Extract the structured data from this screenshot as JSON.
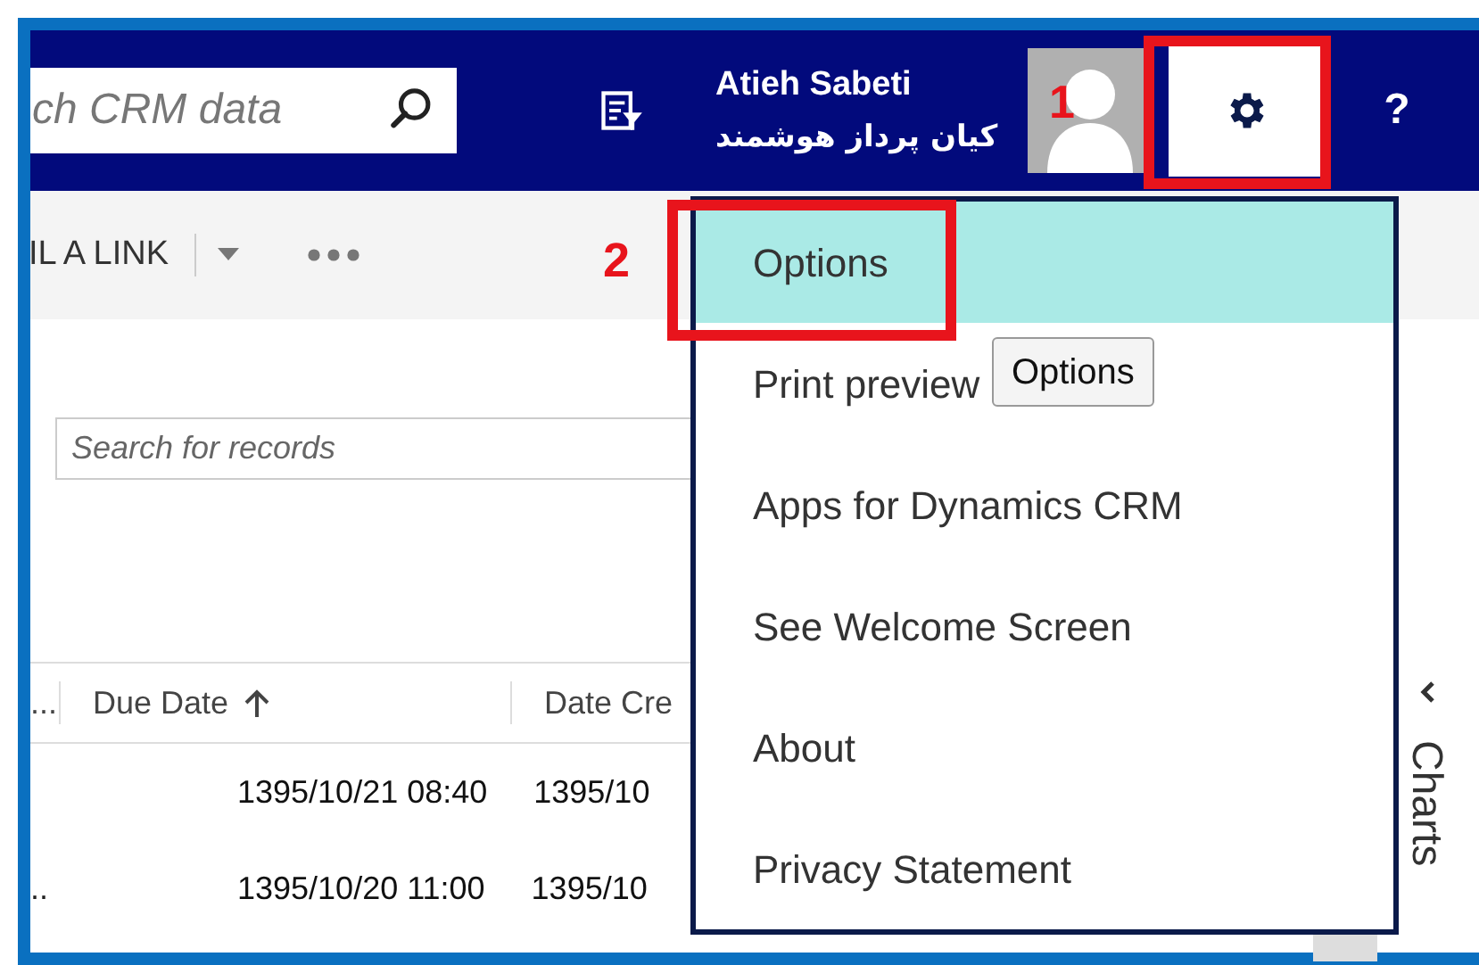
{
  "global_search": {
    "placeholder": "ch CRM data"
  },
  "user": {
    "name": "Atieh Sabeti",
    "organization": "کیان پرداز هوشمند"
  },
  "help_button": {
    "label": "?"
  },
  "command_bar": {
    "label": "IL A LINK"
  },
  "records_search": {
    "placeholder": "Search for records"
  },
  "grid": {
    "columns": [
      {
        "label": "...",
        "sorted": false
      },
      {
        "label": "Due Date",
        "sorted": true
      },
      {
        "label": "Date Cre",
        "sorted": false
      }
    ],
    "rows": [
      {
        "cells": [
          "1395/10/21 08:40",
          "1395/10"
        ]
      },
      {
        "lead": "..",
        "cells": [
          "1395/10/20 11:00",
          "1395/10"
        ]
      }
    ]
  },
  "settings_menu": {
    "items": [
      {
        "label": "Options",
        "selected": true
      },
      {
        "label": "Print preview",
        "selected": false
      },
      {
        "label": "Apps for Dynamics CRM",
        "selected": false
      },
      {
        "label": "See Welcome Screen",
        "selected": false
      },
      {
        "label": "About",
        "selected": false
      },
      {
        "label": "Privacy Statement",
        "selected": false
      }
    ]
  },
  "tooltip": {
    "text": "Options"
  },
  "side_panel": {
    "title": "Charts"
  },
  "annotations": [
    {
      "label": "1"
    },
    {
      "label": "2"
    }
  ]
}
